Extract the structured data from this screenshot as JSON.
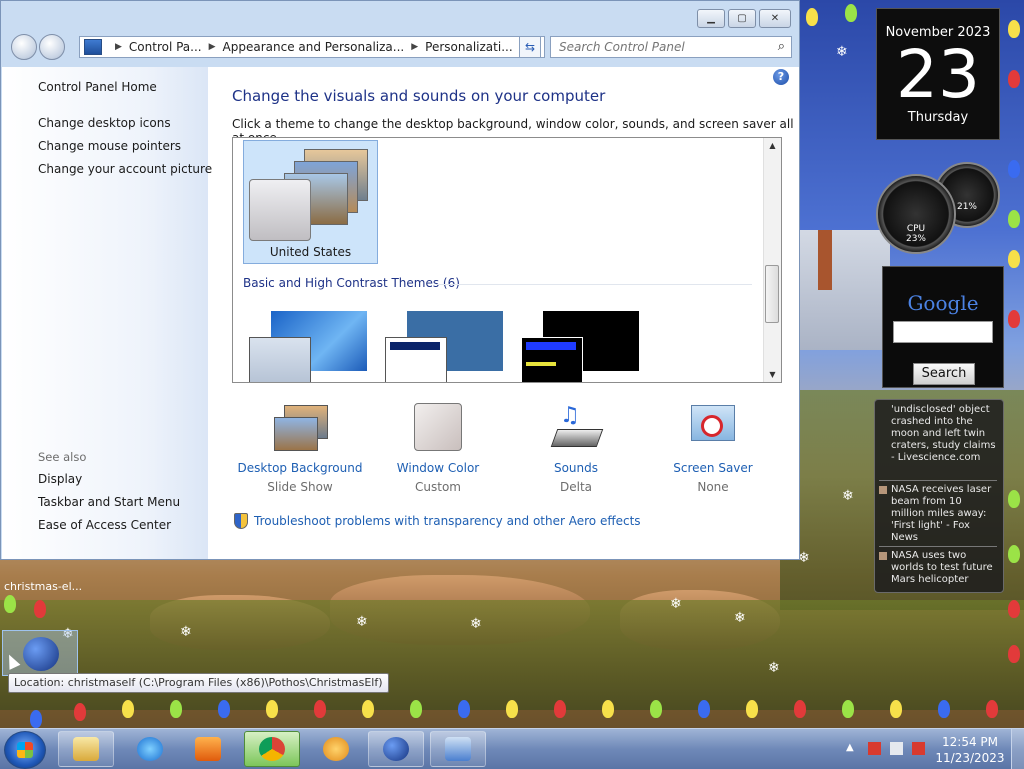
{
  "window": {
    "address": {
      "crumbs": [
        "Control Pa...",
        "Appearance and Personaliza...",
        "Personalizati..."
      ]
    },
    "search_placeholder": "Search Control Panel",
    "left": {
      "home": "Control Panel Home",
      "links": [
        "Change desktop icons",
        "Change mouse pointers",
        "Change your account picture"
      ],
      "see_also_label": "See also",
      "see_also": [
        "Display",
        "Taskbar and Start Menu",
        "Ease of Access Center"
      ]
    },
    "heading": "Change the visuals and sounds on your computer",
    "subheading": "Click a theme to change the desktop background, window color, sounds, and screen saver all at once.",
    "selected_theme": "United States",
    "basic_group_label": "Basic and High Contrast Themes (6)",
    "settings": [
      {
        "label": "Desktop Background",
        "value": "Slide Show"
      },
      {
        "label": "Window Color",
        "value": "Custom"
      },
      {
        "label": "Sounds",
        "value": "Delta"
      },
      {
        "label": "Screen Saver",
        "value": "None"
      }
    ],
    "troubleshoot_link": "Troubleshoot problems with transparency and other Aero effects"
  },
  "gadgets": {
    "calendar": {
      "month": "November 2023",
      "day": "23",
      "weekday": "Thursday"
    },
    "meter": {
      "cpu_pct": "23%",
      "mem_pct": "21%",
      "cpu_label": "CPU"
    },
    "google": {
      "logo": "Google",
      "search_button": "Search"
    },
    "news": [
      "'undisclosed' object crashed into the moon and left twin craters, study claims - Livescience.com",
      "NASA receives laser beam from 10 million miles away: 'First light' - Fox News",
      "NASA uses two worlds to test future Mars helicopter"
    ]
  },
  "desktop": {
    "icon_label": "christmas-el...",
    "tooltip": "Location: christmaself (C:\\Program Files (x86)\\Pothos\\ChristmasElf)"
  },
  "taskbar": {
    "time": "12:54 PM",
    "date": "11/23/2023"
  },
  "colors": {
    "link": "#1e5fb3",
    "heading": "#1e3287"
  }
}
